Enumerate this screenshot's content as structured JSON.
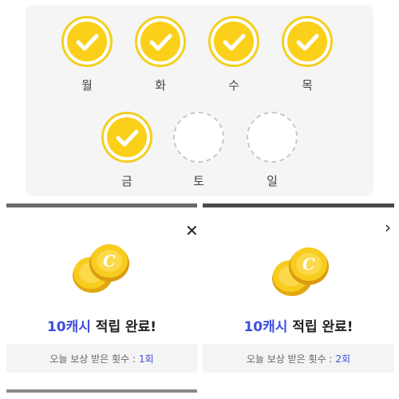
{
  "attendance": {
    "days": [
      {
        "label": "월",
        "stamped": true
      },
      {
        "label": "화",
        "stamped": true
      },
      {
        "label": "수",
        "stamped": true
      },
      {
        "label": "목",
        "stamped": true
      },
      {
        "label": "금",
        "stamped": true
      },
      {
        "label": "토",
        "stamped": false
      },
      {
        "label": "일",
        "stamped": false
      }
    ]
  },
  "popups": [
    {
      "close_icon": "close-icon",
      "cash_amount": "10캐시",
      "cash_rest": " 적립 완료!",
      "sub_text": "오늘 보상 받은 횟수 :",
      "sub_count": "1회"
    },
    {
      "close_icon": "chevron-right-icon",
      "cash_amount": "10캐시",
      "cash_rest": " 적립 완료!",
      "sub_text": "오늘 보상 받은 횟수 :",
      "sub_count": "2회"
    }
  ],
  "colors": {
    "stamp_yellow": "#fbd01a",
    "accent_blue": "#3d4ee3",
    "coin_gold": "#f3c21a"
  }
}
